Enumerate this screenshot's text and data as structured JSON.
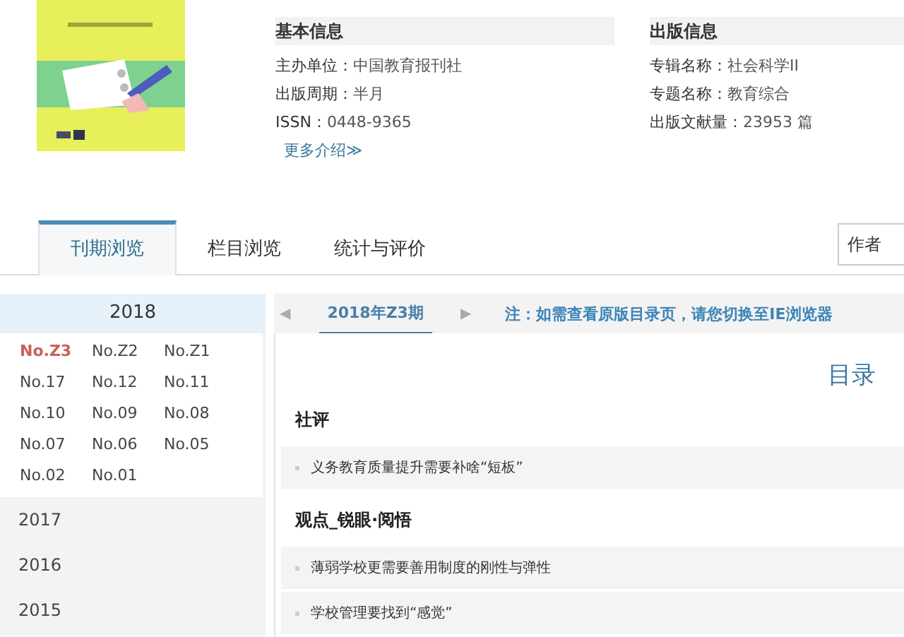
{
  "journal": {
    "more_link": "更多介绍≫"
  },
  "basic_info": {
    "heading": "基本信息",
    "fields": [
      {
        "label": "主办单位：",
        "value": "中国教育报刊社"
      },
      {
        "label": "出版周期：",
        "value": "半月"
      },
      {
        "label": "ISSN：",
        "value": "0448-9365"
      }
    ]
  },
  "publication_info": {
    "heading": "出版信息",
    "fields": [
      {
        "label": "专辑名称：",
        "value": "社会科学II"
      },
      {
        "label": "专题名称：",
        "value": "教育综合"
      },
      {
        "label": "出版文献量：",
        "value": "23953 篇"
      }
    ]
  },
  "tabs": [
    {
      "label": "刊期浏览",
      "selected": true
    },
    {
      "label": "栏目浏览",
      "selected": false
    },
    {
      "label": "统计与评价",
      "selected": false
    }
  ],
  "search": {
    "value": "作者"
  },
  "years": [
    {
      "year": "2018",
      "expanded": true,
      "issues": [
        {
          "label": "No.Z3",
          "selected": true
        },
        {
          "label": "No.Z2",
          "selected": false
        },
        {
          "label": "No.Z1",
          "selected": false
        },
        {
          "label": "No.17",
          "selected": false
        },
        {
          "label": "No.12",
          "selected": false
        },
        {
          "label": "No.11",
          "selected": false
        },
        {
          "label": "No.10",
          "selected": false
        },
        {
          "label": "No.09",
          "selected": false
        },
        {
          "label": "No.08",
          "selected": false
        },
        {
          "label": "No.07",
          "selected": false
        },
        {
          "label": "No.06",
          "selected": false
        },
        {
          "label": "No.05",
          "selected": false
        },
        {
          "label": "No.02",
          "selected": false
        },
        {
          "label": "No.01",
          "selected": false
        }
      ]
    },
    {
      "year": "2017",
      "expanded": false
    },
    {
      "year": "2016",
      "expanded": false
    },
    {
      "year": "2015",
      "expanded": false
    }
  ],
  "issue_nav": {
    "prev": "◀",
    "current": "2018年Z3期",
    "next": "▶",
    "note": "注：如需查看原版目录页，请您切换至IE浏览器"
  },
  "toc": {
    "title": "目录",
    "sections": [
      {
        "heading": "社评",
        "articles": [
          "义务教育质量提升需要补啥“短板”"
        ]
      },
      {
        "heading": "观点_锐眼·阅悟",
        "articles": [
          "薄弱学校更需要善用制度的刚性与弹性",
          "学校管理要找到“感觉”"
        ]
      }
    ]
  }
}
